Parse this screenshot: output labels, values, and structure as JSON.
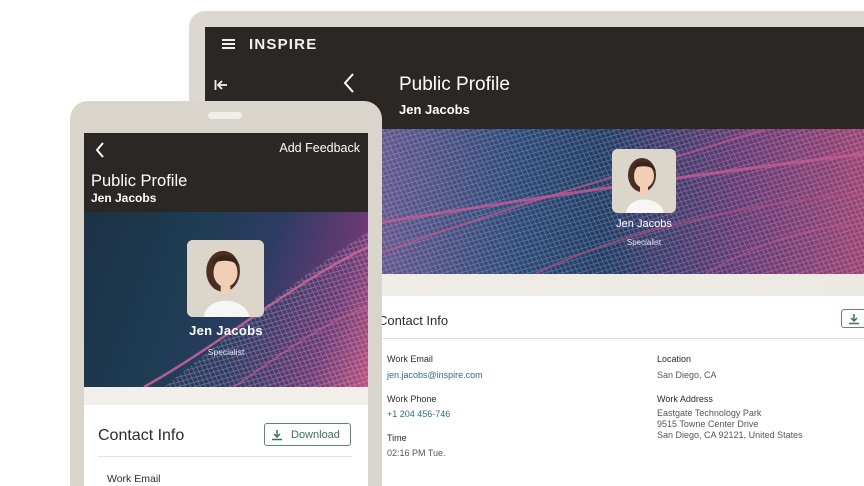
{
  "brand": "INSPIRE",
  "profile": {
    "page_title": "Public Profile",
    "name": "Jen Jacobs",
    "role": "Specialist"
  },
  "tablet": {
    "contact_title": "Contact Info",
    "fields": {
      "work_email": {
        "label": "Work Email",
        "value": "jen.jacobs@inspire.com"
      },
      "work_phone": {
        "label": "Work Phone",
        "value": "+1 204 456-746"
      },
      "time": {
        "label": "Time",
        "value": "02:16 PM Tue."
      },
      "location": {
        "label": "Location",
        "value": "San Diego, CA"
      },
      "work_address": {
        "label": "Work Address",
        "line1": "Eastgate Technology Park",
        "line2": "9515 Towne Center Drive",
        "line3": "San Diego, CA 92121, United States"
      }
    }
  },
  "phone": {
    "add_feedback": "Add Feedback",
    "contact_title": "Contact Info",
    "download_label": "Download",
    "work_email_label": "Work Email"
  },
  "icons": {
    "menu": "hamburger-icon",
    "collapse": "collapse-left-icon",
    "back": "chevron-left-icon",
    "download": "download-icon"
  },
  "colors": {
    "header_bg": "#2a2725",
    "link": "#2f6f73",
    "button_border": "#5a8a6a",
    "device_frame": "#d9d4cc"
  }
}
